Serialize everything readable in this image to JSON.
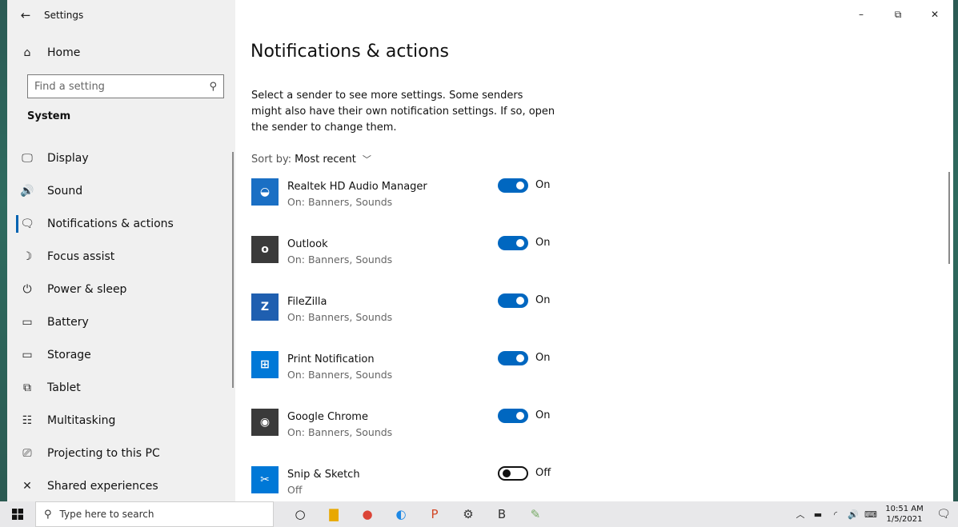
{
  "window": {
    "app_title": "Settings",
    "controls": {
      "minimize": "–",
      "restore": "⧉",
      "close": "✕"
    }
  },
  "sidebar": {
    "home_label": "Home",
    "search_placeholder": "Find a setting",
    "section_title": "System",
    "items": [
      {
        "label": "Display",
        "icon": "display-icon",
        "glyph": "🖵"
      },
      {
        "label": "Sound",
        "icon": "sound-icon",
        "glyph": "🔊"
      },
      {
        "label": "Notifications & actions",
        "icon": "notifications-icon",
        "glyph": "🗨",
        "selected": true
      },
      {
        "label": "Focus assist",
        "icon": "focus-assist-icon",
        "glyph": "☽"
      },
      {
        "label": "Power & sleep",
        "icon": "power-icon",
        "glyph": "⏻"
      },
      {
        "label": "Battery",
        "icon": "battery-icon",
        "glyph": "▭"
      },
      {
        "label": "Storage",
        "icon": "storage-icon",
        "glyph": "▭"
      },
      {
        "label": "Tablet",
        "icon": "tablet-icon",
        "glyph": "⧉"
      },
      {
        "label": "Multitasking",
        "icon": "multitasking-icon",
        "glyph": "☷"
      },
      {
        "label": "Projecting to this PC",
        "icon": "projecting-icon",
        "glyph": "⎚"
      },
      {
        "label": "Shared experiences",
        "icon": "shared-experiences-icon",
        "glyph": "✕"
      }
    ]
  },
  "main": {
    "title": "Notifications & actions",
    "description": "Select a sender to see more settings. Some senders might also have their own notification settings. If so, open the sender to change them.",
    "sort_label": "Sort by:",
    "sort_value": "Most recent",
    "senders": [
      {
        "name": "Realtek HD Audio Manager",
        "sub": "On: Banners, Sounds",
        "state": "On",
        "on": true,
        "icon": "realtek-icon",
        "color": "#1a6fc4"
      },
      {
        "name": "Outlook",
        "sub": "On: Banners, Sounds",
        "state": "On",
        "on": true,
        "icon": "outlook-icon",
        "color": "#3a3a3a"
      },
      {
        "name": "FileZilla",
        "sub": "On: Banners, Sounds",
        "state": "On",
        "on": true,
        "icon": "filezilla-icon",
        "color": "#1f5fb0"
      },
      {
        "name": "Print Notification",
        "sub": "On: Banners, Sounds",
        "state": "On",
        "on": true,
        "icon": "print-notification-icon",
        "color": "#0078d7"
      },
      {
        "name": "Google Chrome",
        "sub": "On: Banners, Sounds",
        "state": "On",
        "on": true,
        "icon": "chrome-icon",
        "color": "#3a3a3a"
      },
      {
        "name": "Snip & Sketch",
        "sub": "Off",
        "state": "Off",
        "on": false,
        "icon": "snip-sketch-icon",
        "color": "#0078d7"
      }
    ]
  },
  "taskbar": {
    "search_placeholder": "Type here to search",
    "apps": [
      {
        "icon": "cortana-icon",
        "glyph": "○"
      },
      {
        "icon": "file-explorer-icon",
        "glyph": "▇"
      },
      {
        "icon": "chrome-taskbar-icon",
        "glyph": "●"
      },
      {
        "icon": "edge-icon",
        "glyph": "◐"
      },
      {
        "icon": "powerpoint-icon",
        "glyph": "P"
      },
      {
        "icon": "settings-taskbar-icon",
        "glyph": "⚙"
      },
      {
        "icon": "b-app-icon",
        "glyph": "B"
      },
      {
        "icon": "paint-icon",
        "glyph": "✎"
      }
    ],
    "time": "10:51 AM",
    "date": "1/5/2021"
  }
}
